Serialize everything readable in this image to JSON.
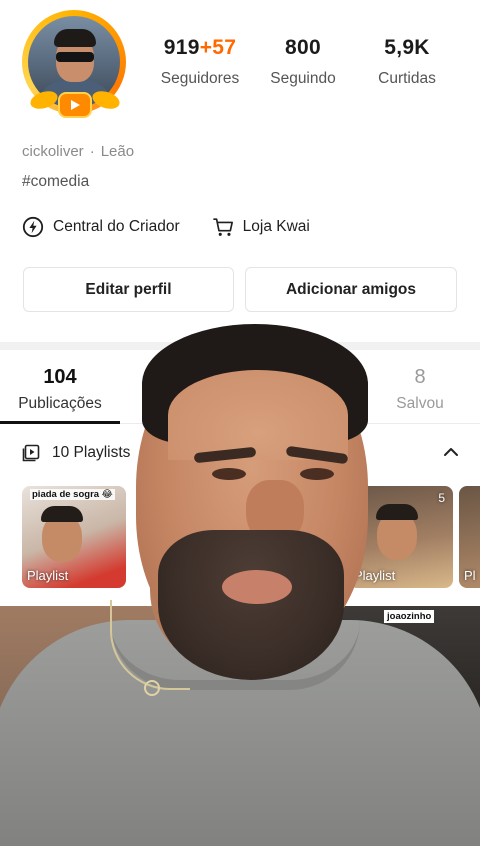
{
  "profile": {
    "stats": {
      "followers": {
        "value": "919",
        "delta": "+57",
        "label": "Seguidores"
      },
      "following": {
        "value": "800",
        "label": "Seguindo"
      },
      "likes": {
        "value": "5,9K",
        "label": "Curtidas"
      }
    },
    "username": "cickoliver",
    "separator": "·",
    "zodiac": "Leão",
    "hashtag": "#comedia",
    "links": {
      "creator_center": "Central do Criador",
      "kwai_shop": "Loja Kwai"
    },
    "buttons": {
      "edit_profile": "Editar perfil",
      "add_friends": "Adicionar amigos"
    }
  },
  "tabs": {
    "posts": {
      "count": "104",
      "label": "Publicações"
    },
    "saved": {
      "count": "8",
      "label": "Salvou"
    }
  },
  "playlists": {
    "header": "10 Playlists",
    "items": [
      {
        "caption": "piada de sogra 😂",
        "label": "Playlist"
      },
      {
        "count": "5",
        "label": "Playlist"
      },
      {
        "label": "Pl"
      }
    ]
  },
  "grid": {
    "captions": [
      "joaozinho"
    ]
  },
  "colors": {
    "accent": "#ff6a00",
    "avatar_ring": "#ffb300"
  },
  "icons": [
    "play-badge-icon",
    "lightning-icon",
    "cart-icon",
    "playlist-icon",
    "chevron-up-icon"
  ]
}
